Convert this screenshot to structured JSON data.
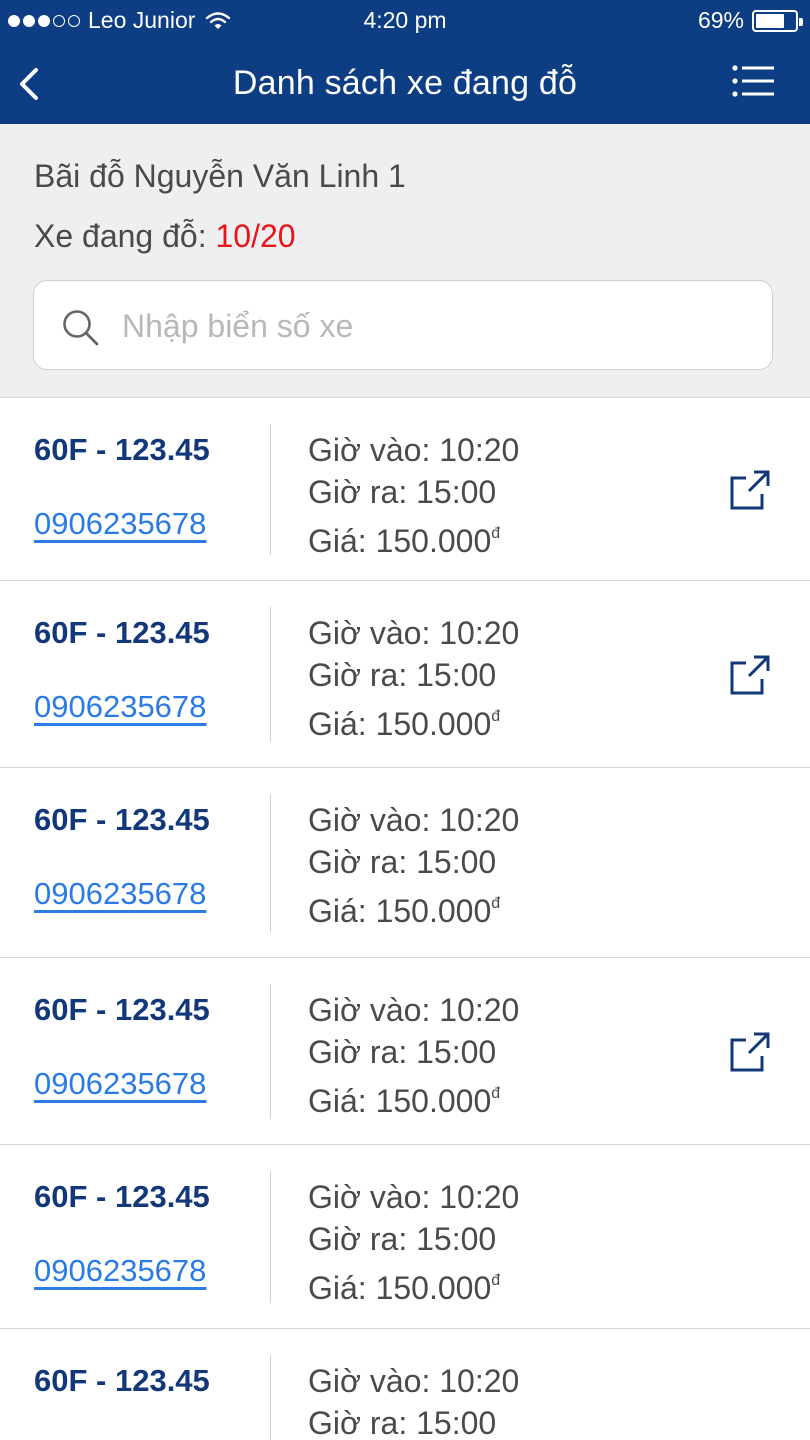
{
  "status_bar": {
    "carrier": "Leo Junior",
    "time": "4:20 pm",
    "battery": "69%"
  },
  "nav": {
    "title": "Danh sách xe đang đỗ",
    "icons": [
      "chevron-left-icon",
      "list-menu-icon"
    ]
  },
  "lot": {
    "name": "Bãi đỗ Nguyễn Văn Linh 1",
    "count_label": "Xe đang đỗ: ",
    "count_value": "10/20"
  },
  "search": {
    "placeholder": "Nhập biển số xe",
    "value": ""
  },
  "colors": {
    "header": "#0d3d82",
    "plate": "#13387a",
    "phone_link": "#2a7be4",
    "count": "#e8141b"
  },
  "vehicles": [
    {
      "plate": "60F - 123.45",
      "phone": "0906235678",
      "in_label": "Giờ vào: ",
      "in_time": "10:20",
      "out_label": "Giờ ra: ",
      "out_time": "15:00",
      "price_label": "Giá: ",
      "price": "150.000",
      "currency": "đ",
      "has_link": true
    },
    {
      "plate": "60F - 123.45",
      "phone": "0906235678",
      "in_label": "Giờ vào: ",
      "in_time": "10:20",
      "out_label": "Giờ ra: ",
      "out_time": "15:00",
      "price_label": "Giá: ",
      "price": "150.000",
      "currency": "đ",
      "has_link": true
    },
    {
      "plate": "60F - 123.45",
      "phone": "0906235678",
      "in_label": "Giờ vào: ",
      "in_time": "10:20",
      "out_label": "Giờ ra: ",
      "out_time": "15:00",
      "price_label": "Giá: ",
      "price": "150.000",
      "currency": "đ",
      "has_link": false
    },
    {
      "plate": "60F - 123.45",
      "phone": "0906235678",
      "in_label": "Giờ vào: ",
      "in_time": "10:20",
      "out_label": "Giờ ra: ",
      "out_time": "15:00",
      "price_label": "Giá: ",
      "price": "150.000",
      "currency": "đ",
      "has_link": true
    },
    {
      "plate": "60F - 123.45",
      "phone": "0906235678",
      "in_label": "Giờ vào: ",
      "in_time": "10:20",
      "out_label": "Giờ ra: ",
      "out_time": "15:00",
      "price_label": "Giá: ",
      "price": "150.000",
      "currency": "đ",
      "has_link": false
    },
    {
      "plate": "60F - 123.45",
      "phone": "",
      "in_label": "Giờ vào: ",
      "in_time": "10:20",
      "out_label": "Giờ ra: ",
      "out_time": "15:00",
      "price_label": "",
      "price": "",
      "currency": "",
      "has_link": false
    }
  ]
}
